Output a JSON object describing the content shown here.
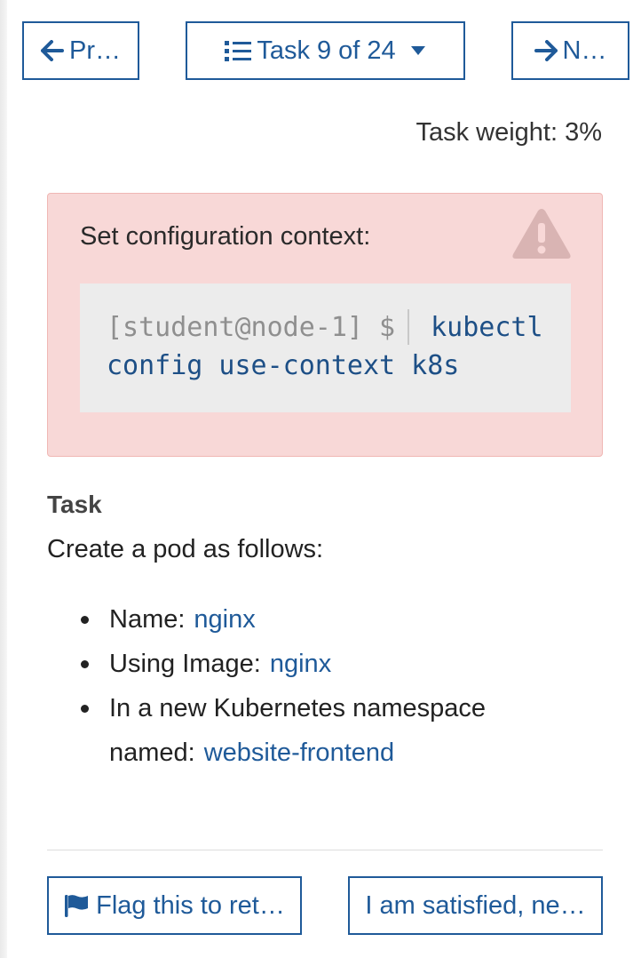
{
  "nav": {
    "prev_label": "Pr…",
    "task_menu_label": "Task 9 of 24",
    "next_label": "N…"
  },
  "task_weight": "Task weight: 3%",
  "alert": {
    "title": "Set configuration context:",
    "prompt": "[student@node-1] $",
    "command": "kubectl config use-context k8s"
  },
  "task": {
    "heading": "Task",
    "intro": "Create a pod as follows:",
    "items": [
      {
        "label": "Name:",
        "value": "nginx"
      },
      {
        "label": "Using Image:",
        "value": "nginx"
      },
      {
        "label": "In a new Kubernetes namespace named:",
        "value": "website-frontend"
      }
    ]
  },
  "footer": {
    "flag_label": "Flag this to ret…",
    "satisfied_label": "I am satisfied, ne…"
  },
  "icons": {
    "prev": "arrow-left-icon",
    "menu": "list-icon",
    "caret": "caret-down-icon",
    "next": "arrow-right-icon",
    "warning": "warning-icon",
    "flag": "flag-icon"
  },
  "colors": {
    "accent": "#1f5a99",
    "alert_bg": "#f8d8d7",
    "code_bg": "#ececec"
  }
}
